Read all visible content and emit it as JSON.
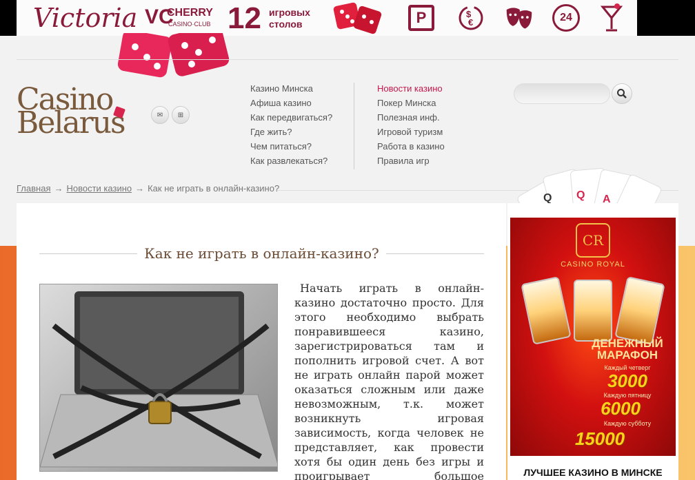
{
  "banner": {
    "brand": "Victoria",
    "vc": "VC",
    "cherry": "CHERRY",
    "club": "CASINO·CLUB",
    "tables_count": "12",
    "tables_label_1": "игровых",
    "tables_label_2": "столов",
    "icons": [
      "parking-icon",
      "currency-exchange-icon",
      "theatre-masks-icon",
      "24h-icon",
      "cocktail-icon"
    ],
    "parking_glyph": "P",
    "hours_glyph": "24"
  },
  "logo": {
    "line1": "Casino",
    "line2": "Belarus"
  },
  "nav": {
    "col1": [
      "Казино Минска",
      "Афиша казино",
      "Как передвигаться?",
      "Где жить?",
      "Чем питаться?",
      "Как развлекаться?"
    ],
    "col2": [
      "Новости казино",
      "Покер Минска",
      "Полезная инф.",
      "Игровой туризм",
      "Работа в казино",
      "Правила игр"
    ]
  },
  "search": {
    "value": ""
  },
  "breadcrumb": {
    "home": "Главная",
    "section": "Новости казино",
    "current": "Как не играть в онлайн-казино?",
    "separator": "→"
  },
  "article": {
    "title": "Как не играть в онлайн-казино?",
    "body": "Начать играть в онлайн-казино достаточно просто. Для этого необходимо выбрать понравившееся казино, зарегистрироваться там и пополнить игровой счет. А вот не играть онлайн парой может оказаться сложным или даже невозможным, т.к. может возникнуть игровая зависимость, когда человек не представляет, как провести хотя бы один день без игры и проигрывает большое количество денег."
  },
  "sidebar": {
    "ad": {
      "crest": "CR",
      "casino_name": "CASINO ROYAL",
      "marathon_1": "ДЕНЕЖНЫЙ",
      "marathon_2": "МАРАФОН",
      "events": [
        "Каждый четверг",
        "Каждую пятницу",
        "Каждую субботу"
      ],
      "amounts": [
        "3000",
        "6000",
        "15000"
      ]
    },
    "title": "ЛУЧШЕЕ КАЗИНО В МИНСКЕ"
  },
  "colors": {
    "accent": "#c4184d",
    "brand_brown": "#7a5a3c",
    "banner_wine": "#8a1a3a"
  }
}
